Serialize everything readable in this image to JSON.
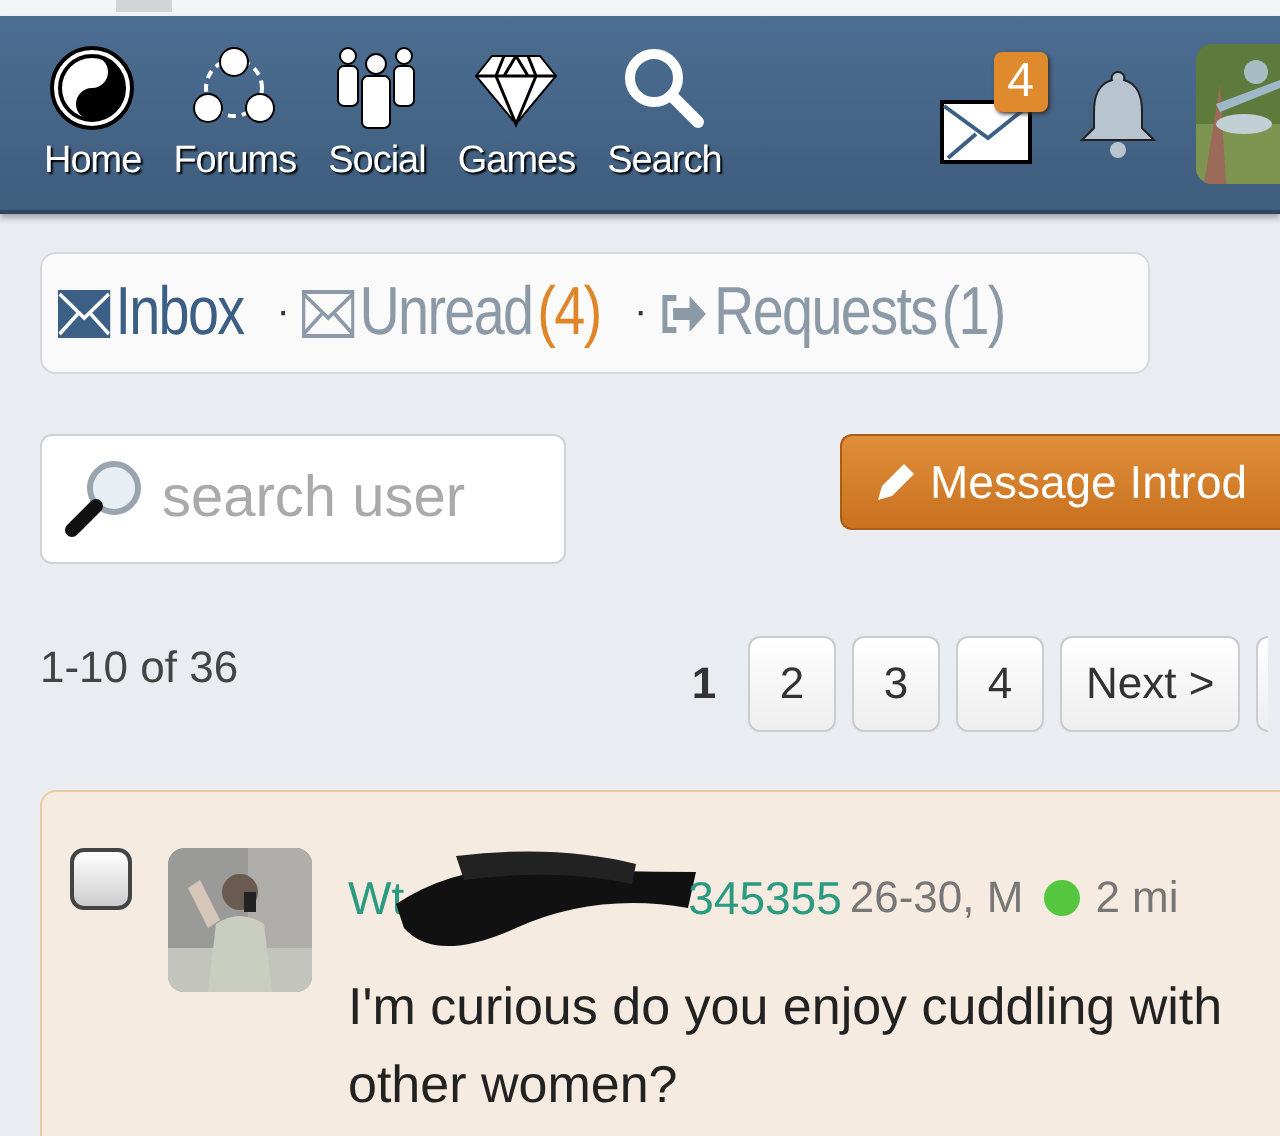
{
  "nav": {
    "items": [
      {
        "label": "Home",
        "kind": "home"
      },
      {
        "label": "Forums",
        "kind": "forums"
      },
      {
        "label": "Social",
        "kind": "social"
      },
      {
        "label": "Games",
        "kind": "games"
      },
      {
        "label": "Search",
        "kind": "search"
      }
    ],
    "mail_badge": "4"
  },
  "folders": {
    "separator": "·",
    "items": [
      {
        "label": "Inbox",
        "kind": "inbox",
        "selected": true
      },
      {
        "label": "Unread",
        "kind": "unread",
        "count": "(4)",
        "highlight": true,
        "selected": false
      },
      {
        "label": "Requests",
        "kind": "requests",
        "count": "(1)",
        "highlight": false,
        "selected": false
      }
    ]
  },
  "search": {
    "placeholder": "search user"
  },
  "compose_button": "Message Introd",
  "range": "1-10 of 36",
  "pages": [
    {
      "label": "1",
      "selected": true
    },
    {
      "label": "2",
      "selected": false
    },
    {
      "label": "3",
      "selected": false
    },
    {
      "label": "4",
      "selected": false
    }
  ],
  "next": "Next >",
  "messages": [
    {
      "checked": false,
      "name_start": "Wt",
      "name_end": "345355",
      "meta": "26-30, M",
      "online": true,
      "time": "2 mi",
      "text": "I'm curious do you enjoy cuddling with other women?"
    }
  ]
}
